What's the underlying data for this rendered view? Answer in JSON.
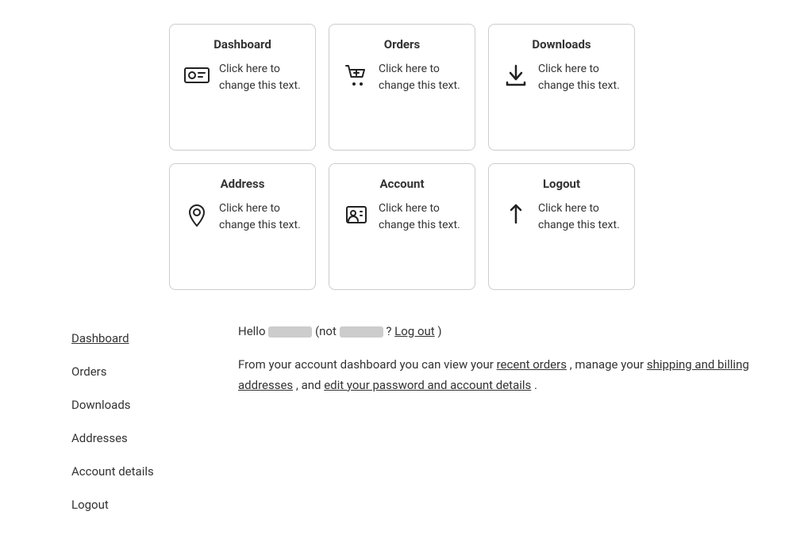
{
  "cards": [
    {
      "id": "dashboard",
      "title": "Dashboard",
      "text": "Click here to change this text.",
      "icon": "id-card"
    },
    {
      "id": "orders",
      "title": "Orders",
      "text": "Click here to change this text.",
      "icon": "cart"
    },
    {
      "id": "downloads",
      "title": "Downloads",
      "text": "Click here to change this text.",
      "icon": "download"
    },
    {
      "id": "address",
      "title": "Address",
      "text": "Click here to change this text.",
      "icon": "location"
    },
    {
      "id": "account",
      "title": "Account",
      "text": "Click here to change this text.",
      "icon": "account"
    },
    {
      "id": "logout",
      "title": "Logout",
      "text": "Click here to change this text.",
      "icon": "logout"
    }
  ],
  "sidebar": {
    "items": [
      {
        "label": "Dashboard",
        "active": true
      },
      {
        "label": "Orders",
        "active": false
      },
      {
        "label": "Downloads",
        "active": false
      },
      {
        "label": "Addresses",
        "active": false
      },
      {
        "label": "Account details",
        "active": false
      },
      {
        "label": "Logout",
        "active": false
      }
    ]
  },
  "greeting": {
    "hello_prefix": "Hello",
    "not_prefix": "(not",
    "question": "?",
    "log_out_label": "Log out",
    "close_paren": ")"
  },
  "description": {
    "text_before_orders": "From your account dashboard you can view your",
    "orders_link": "recent orders",
    "text_between_1": ", manage your",
    "addresses_link": "shipping and billing addresses",
    "text_between_2": ", and",
    "account_link": "edit your password and account details",
    "text_end": "."
  }
}
